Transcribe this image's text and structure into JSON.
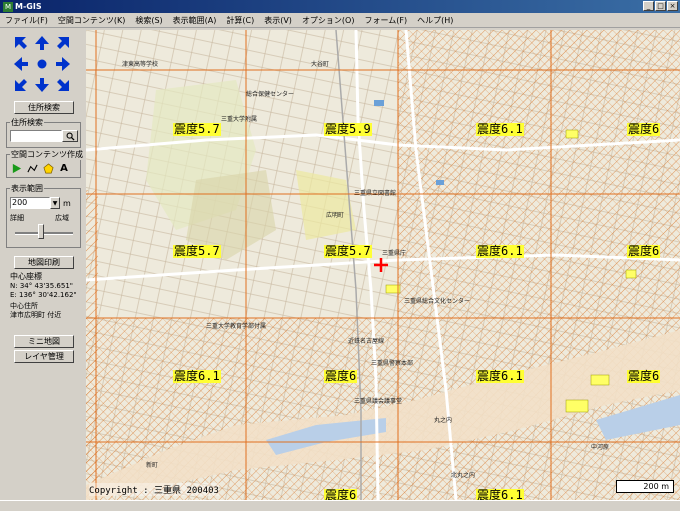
{
  "window": {
    "app_icon_label": "M",
    "title": "M-GIS",
    "minimize": "_",
    "maximize": "□",
    "close": "×"
  },
  "menu": [
    "ファイル(F)",
    "空間コンテンツ(K)",
    "検索(S)",
    "表示範囲(A)",
    "計算(C)",
    "表示(V)",
    "オプション(O)",
    "フォーム(F)",
    "ヘルプ(H)"
  ],
  "panel": {
    "address_search_button": "住所検索",
    "address_search_group": "住所検索",
    "address_search_value": "",
    "contents_group": "空間コンテンツ作成",
    "text_tool": "A",
    "range_group": "表示範囲",
    "range_value": "200",
    "range_unit": "m",
    "slider_detail": "詳細",
    "slider_wide": "広域",
    "slider_level": 0.45,
    "print_button": "地図印刷",
    "center_title": "中心座標",
    "lat": "N:  34°  43'35.651\"",
    "lon": "E:  136°  30'42.162\"",
    "addr_title": "中心住所",
    "addr_value": "津市広明町 付近",
    "mini_map_button": "ミニ地図",
    "layer_button": "レイヤ管理"
  },
  "map": {
    "quake_labels": [
      {
        "text": "震度5.7"
      },
      {
        "text": "震度5.9"
      },
      {
        "text": "震度6.1"
      },
      {
        "text": "震度6"
      },
      {
        "text": "震度5.7"
      },
      {
        "text": "震度5.7"
      },
      {
        "text": "震度6.1"
      },
      {
        "text": "震度6"
      },
      {
        "text": "震度6.1"
      },
      {
        "text": "震度6"
      },
      {
        "text": "震度6.1"
      },
      {
        "text": "震度6"
      },
      {
        "text": "震度6"
      },
      {
        "text": "震度6.1"
      }
    ],
    "place_labels": [
      "津東高等学校",
      "大谷町",
      "総合保健センター",
      "三重大学附属",
      "広明町",
      "三重県立図書館",
      "三重県庁",
      "三重県総合文化センター",
      "三重大学教育学部付属",
      "近鉄名古屋線",
      "三重県警察本部",
      "三重県議会議事堂",
      "丸之内",
      "北丸之内",
      "中河原",
      "新町"
    ],
    "copyright": "Copyright : 三重県 200403",
    "scale": "200 m",
    "colors": {
      "zone_6": "#e8a070",
      "zone_5": "#f0c8a0",
      "grid": "#e07020",
      "road": "#ffffff",
      "river": "#b9cfe8",
      "water_bodies": "#6aa0d8",
      "highlight": "#ffff33",
      "marker": "#ff0000"
    }
  }
}
